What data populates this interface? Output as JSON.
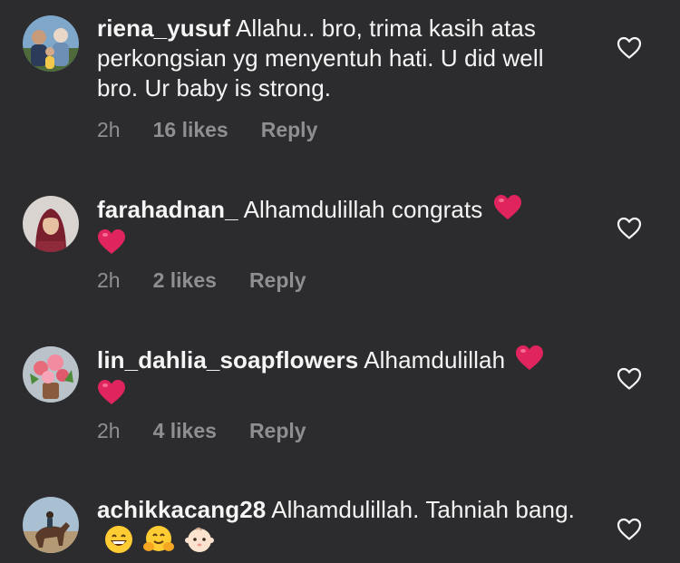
{
  "comments": [
    {
      "username": "riena_yusuf",
      "text": "Allahu.. bro, trima kasih atas perkongsian yg menyentuh hati. U did well bro. Ur baby is strong.",
      "time": "2h",
      "likes": "16 likes",
      "reply": "Reply",
      "avatar": "family-photo-avatar"
    },
    {
      "username": "farahadnan_",
      "text": "Alhamdulillah congrats",
      "emojis": [
        "red-heart",
        "red-heart"
      ],
      "time": "2h",
      "likes": "2 likes",
      "reply": "Reply",
      "avatar": "woman-hijab-avatar"
    },
    {
      "username": "lin_dahlia_soapflowers",
      "text": "Alhamdulillah",
      "emojis": [
        "red-heart",
        "red-heart"
      ],
      "time": "2h",
      "likes": "4 likes",
      "reply": "Reply",
      "avatar": "flower-bouquet-avatar"
    },
    {
      "username": "achikkacang28",
      "text": "Alhamdulillah. Tahniah bang.",
      "emojis": [
        "grinning-face",
        "hugging-face",
        "baby-face"
      ],
      "avatar": "horse-rider-avatar"
    }
  ],
  "colors": {
    "background": "#2c2c2e",
    "primary_text": "#f5f5f5",
    "secondary_text": "#8e8e93",
    "heart_emoji": "#e0245e"
  }
}
